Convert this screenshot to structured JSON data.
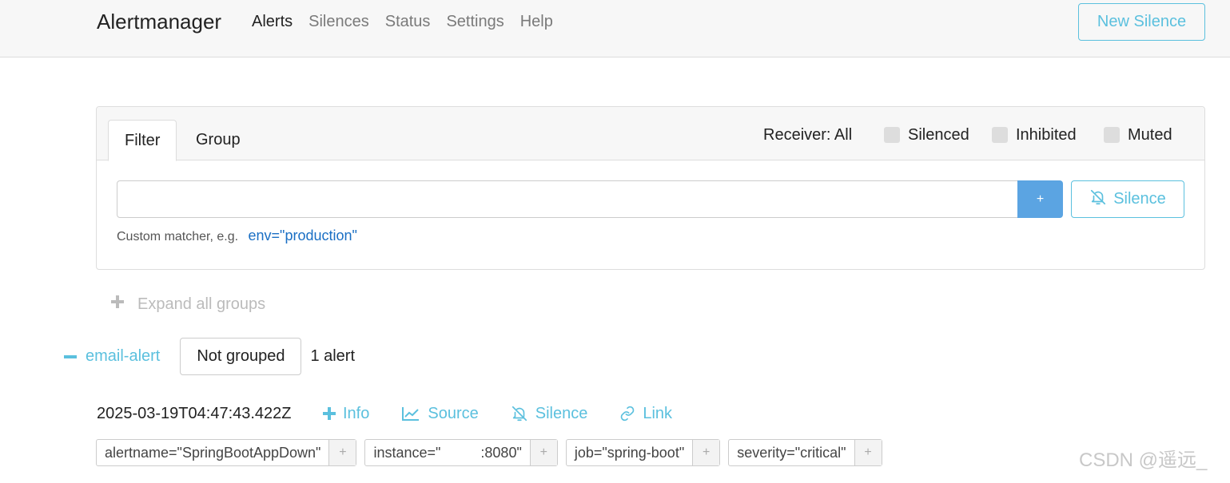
{
  "app": {
    "title": "Alertmanager"
  },
  "nav": {
    "items": [
      "Alerts",
      "Silences",
      "Status",
      "Settings",
      "Help"
    ],
    "active": "Alerts"
  },
  "header": {
    "new_silence_label": "New Silence"
  },
  "filter": {
    "tabs": [
      "Filter",
      "Group"
    ],
    "receiver_label": "Receiver: All",
    "checkboxes": [
      "Silenced",
      "Inhibited",
      "Muted"
    ],
    "input_value": "",
    "add_label": "+",
    "silence_label": "Silence",
    "hint_prefix": "Custom matcher, e.g.",
    "hint_example": "env=\"production\""
  },
  "expand_label": "Expand all groups",
  "group": {
    "name": "email-alert",
    "grouping": "Not grouped",
    "count": "1 alert"
  },
  "alert": {
    "timestamp": "2025-03-19T04:47:43.422Z",
    "actions": [
      "Info",
      "Source",
      "Silence",
      "Link"
    ],
    "labels": [
      "alertname=\"SpringBootAppDown\"",
      "instance=\"          :8080\"",
      "job=\"spring-boot\"",
      "severity=\"critical\""
    ],
    "label_add": "+"
  },
  "watermark": "CSDN @遥远_",
  "colors": {
    "accent": "#5bc0de",
    "primary": "#5ba4e2",
    "link": "#1a6fc4"
  }
}
